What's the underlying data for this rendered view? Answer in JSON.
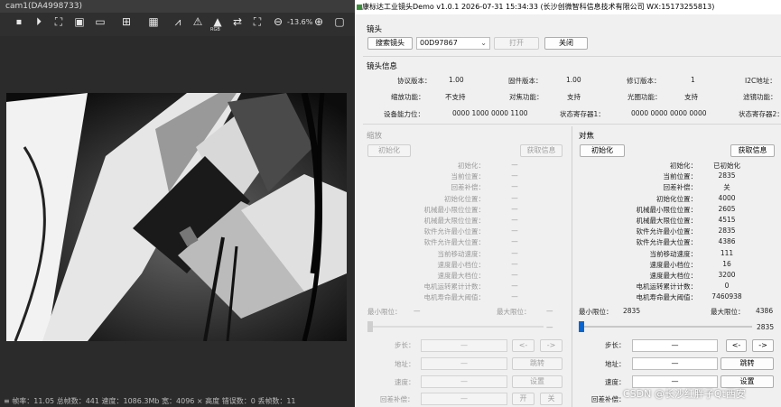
{
  "camera": {
    "title": "cam1(DA4998733)",
    "zoom": "-13.6%",
    "icons": [
      "stop-icon",
      "play-icon",
      "fit-icon",
      "snapshot-icon",
      "record-icon",
      "grid-icon",
      "table-icon",
      "histogram-icon",
      "warning-icon",
      "rgb-icon",
      "swap-icon",
      "crop-icon",
      "zoom-out-icon",
      "zoom-in-icon"
    ],
    "rgb_label": "RGB",
    "status": "≡ 帧率：11.05  总帧数：441  速度：1086.3Mb  宽：4096 × 高度  错误数：0  丢帧数：11"
  },
  "app": {
    "title": "康标达工业镜头Demo v1.0.1 2026-07-31 15:34:33 (长沙创微智科信息技术有限公司 WX:15173255813)",
    "lens": {
      "section": "镜头",
      "search_btn": "搜索镜头",
      "selected": "00D97867",
      "open_btn": "打开",
      "close_btn": "关闭"
    },
    "info": {
      "section": "镜头信息",
      "rows": [
        [
          {
            "k": "协议版本：",
            "v": "1.00"
          },
          {
            "k": "固件版本：",
            "v": "1.00"
          },
          {
            "k": "修订版本：",
            "v": "1"
          },
          {
            "k": "I2C地址：",
            "v": ""
          }
        ],
        [
          {
            "k": "缩放功能：",
            "v": "不支持"
          },
          {
            "k": "对焦功能：",
            "v": "支持"
          },
          {
            "k": "光圈功能：",
            "v": "支持"
          },
          {
            "k": "滤镜功能：",
            "v": ""
          }
        ],
        [
          {
            "k": "设备能力位：",
            "v": "0000 1000 0000 1100"
          },
          {
            "k": "状态寄存器1：",
            "v": "0000 0000 0000 0000"
          },
          {
            "k": "状态寄存器2：",
            "v": ""
          }
        ]
      ]
    },
    "zoom": {
      "section": "缩放",
      "init_btn": "初始化",
      "get_btn": "获取信息",
      "fields": [
        {
          "k": "初始化：",
          "v": "—"
        },
        {
          "k": "当前位置：",
          "v": "—"
        },
        {
          "k": "回差补偿：",
          "v": "—"
        },
        {
          "k": "初始化位置：",
          "v": "—"
        },
        {
          "k": "机械最小限位位置：",
          "v": "—"
        },
        {
          "k": "机械最大限位位置：",
          "v": "—"
        },
        {
          "k": "软件允许最小位置：",
          "v": "—"
        },
        {
          "k": "软件允许最大位置：",
          "v": "—"
        },
        {
          "k": "当前移动速度：",
          "v": "—"
        },
        {
          "k": "速度最小档位：",
          "v": "—"
        },
        {
          "k": "速度最大档位：",
          "v": "—"
        },
        {
          "k": "电机运转累计计数：",
          "v": "—"
        },
        {
          "k": "电机寿命最大阈值：",
          "v": "—"
        }
      ],
      "min_label": "最小限位：",
      "min_val": "—",
      "max_label": "最大限位：",
      "max_val": "—",
      "slider_val": "—",
      "step_label": "步长：",
      "step_val": "—",
      "prev": "<-",
      "next": "->",
      "addr_label": "地址：",
      "addr_val": "—",
      "jump": "跳转",
      "speed_label": "速度：",
      "speed_val": "—",
      "set": "设置",
      "backlash_label": "回差补偿：",
      "backlash_val": "—",
      "on": "开",
      "off": "关"
    },
    "focus": {
      "section": "对焦",
      "init_btn": "初始化",
      "get_btn": "获取信息",
      "fields": [
        {
          "k": "初始化：",
          "v": "已初始化"
        },
        {
          "k": "当前位置：",
          "v": "2835"
        },
        {
          "k": "回差补偿：",
          "v": "关"
        },
        {
          "k": "初始化位置：",
          "v": "4000"
        },
        {
          "k": "机械最小限位位置：",
          "v": "2605"
        },
        {
          "k": "机械最大限位位置：",
          "v": "4515"
        },
        {
          "k": "软件允许最小位置：",
          "v": "2835"
        },
        {
          "k": "软件允许最大位置：",
          "v": "4386"
        },
        {
          "k": "当前移动速度：",
          "v": "111"
        },
        {
          "k": "速度最小档位：",
          "v": "16"
        },
        {
          "k": "速度最大档位：",
          "v": "3200"
        },
        {
          "k": "电机运转累计计数：",
          "v": "0"
        },
        {
          "k": "电机寿命最大阈值：",
          "v": "7460938"
        }
      ],
      "min_label": "最小限位：",
      "min_val": "2835",
      "max_label": "最大限位：",
      "max_val": "4386",
      "slider_val": "2835",
      "slider_fraction": 0,
      "step_label": "步长：",
      "step_val": "—",
      "prev": "<-",
      "next": "->",
      "addr_label": "地址：",
      "addr_val": "—",
      "jump": "跳转",
      "speed_label": "速度：",
      "speed_val": "—",
      "set": "设置",
      "backlash_label": "回差补偿："
    },
    "watermark": "CSDN @长沙红胖子Qt西安"
  }
}
